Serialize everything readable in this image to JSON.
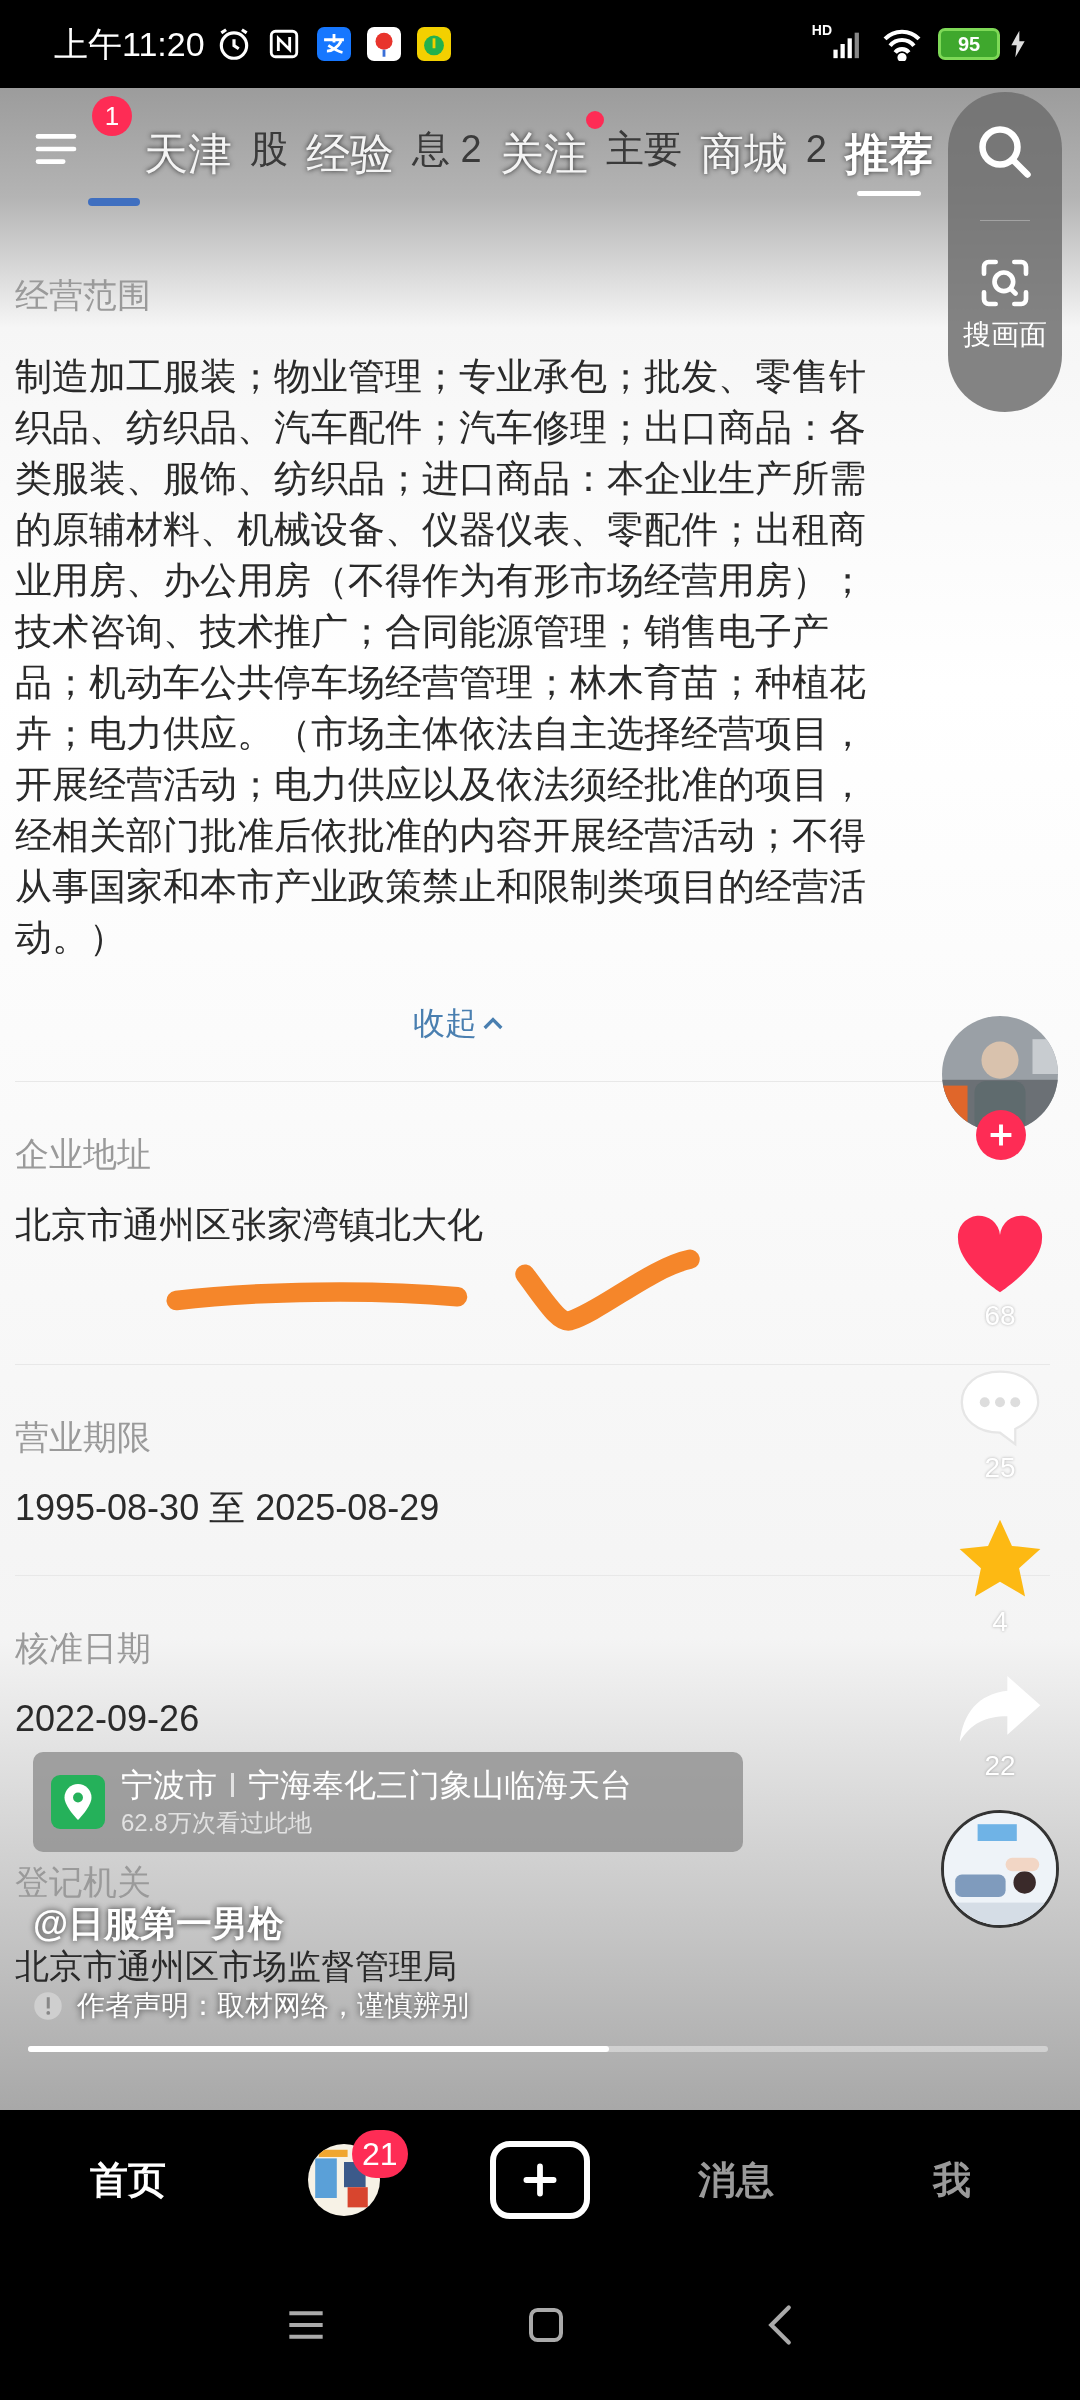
{
  "status_bar": {
    "time": "上午11:20",
    "network": "HD",
    "battery": "95"
  },
  "top_bar": {
    "menu_badge": "1",
    "tabs": [
      {
        "label": "天津",
        "selected": false,
        "dot": false
      },
      {
        "label": "经验",
        "selected": false,
        "dot": false
      },
      {
        "label": "关注",
        "selected": false,
        "dot": true
      },
      {
        "label": "商城",
        "selected": false,
        "dot": false
      },
      {
        "label": "推荐",
        "selected": true,
        "dot": false
      }
    ],
    "background_fragments": [
      "股",
      "息 2",
      "主要",
      "2"
    ]
  },
  "search_panel": {
    "label": "搜画面"
  },
  "business_scope": {
    "label": "经营范围",
    "text": "制造加工服装；物业管理；专业承包；批发、零售针织品、纺织品、汽车配件；汽车修理；出口商品：各类服装、服饰、纺织品；进口商品：本企业生产所需的原辅材料、机械设备、仪器仪表、零配件；出租商业用房、办公用房（不得作为有形市场经营用房）；技术咨询、技术推广；合同能源管理；销售电子产品；机动车公共停车场经营管理；林木育苗；种植花卉；电力供应。（市场主体依法自主选择经营项目，开展经营活动；电力供应以及依法须经批准的项目，经相关部门批准后依批准的内容开展经营活动；不得从事国家和本市产业政策禁止和限制类项目的经营活动。）",
    "collapse": "收起",
    "expanded": true
  },
  "address": {
    "label": "企业地址",
    "value": "北京市通州区张家湾镇北大化"
  },
  "term": {
    "label": "营业期限",
    "value": "1995-08-30 至 2025-08-29"
  },
  "approval": {
    "label": "核准日期",
    "value": "2022-09-26"
  },
  "authority": {
    "label": "登记机关",
    "value": "北京市通州区市场监督管理局"
  },
  "location": {
    "city": "宁波市",
    "areas": "宁海奉化三门象山临海天台",
    "views": "62.8万次看过此地"
  },
  "author": "@日服第一男枪",
  "disclaimer": "作者声明：取材网络，谨慎辨别",
  "side_actions": {
    "likes": "68",
    "liked": true,
    "comments": "25",
    "favorites": "4",
    "favorited": true,
    "shares": "22"
  },
  "progress": {
    "level": 0.57
  },
  "bottom_nav": [
    {
      "kind": "text",
      "label": "首页",
      "selected": true
    },
    {
      "kind": "avatar",
      "badge": "21",
      "selected": false
    },
    {
      "kind": "create",
      "selected": false
    },
    {
      "kind": "text",
      "label": "消息",
      "selected": false
    },
    {
      "kind": "text",
      "label": "我",
      "selected": false
    }
  ]
}
